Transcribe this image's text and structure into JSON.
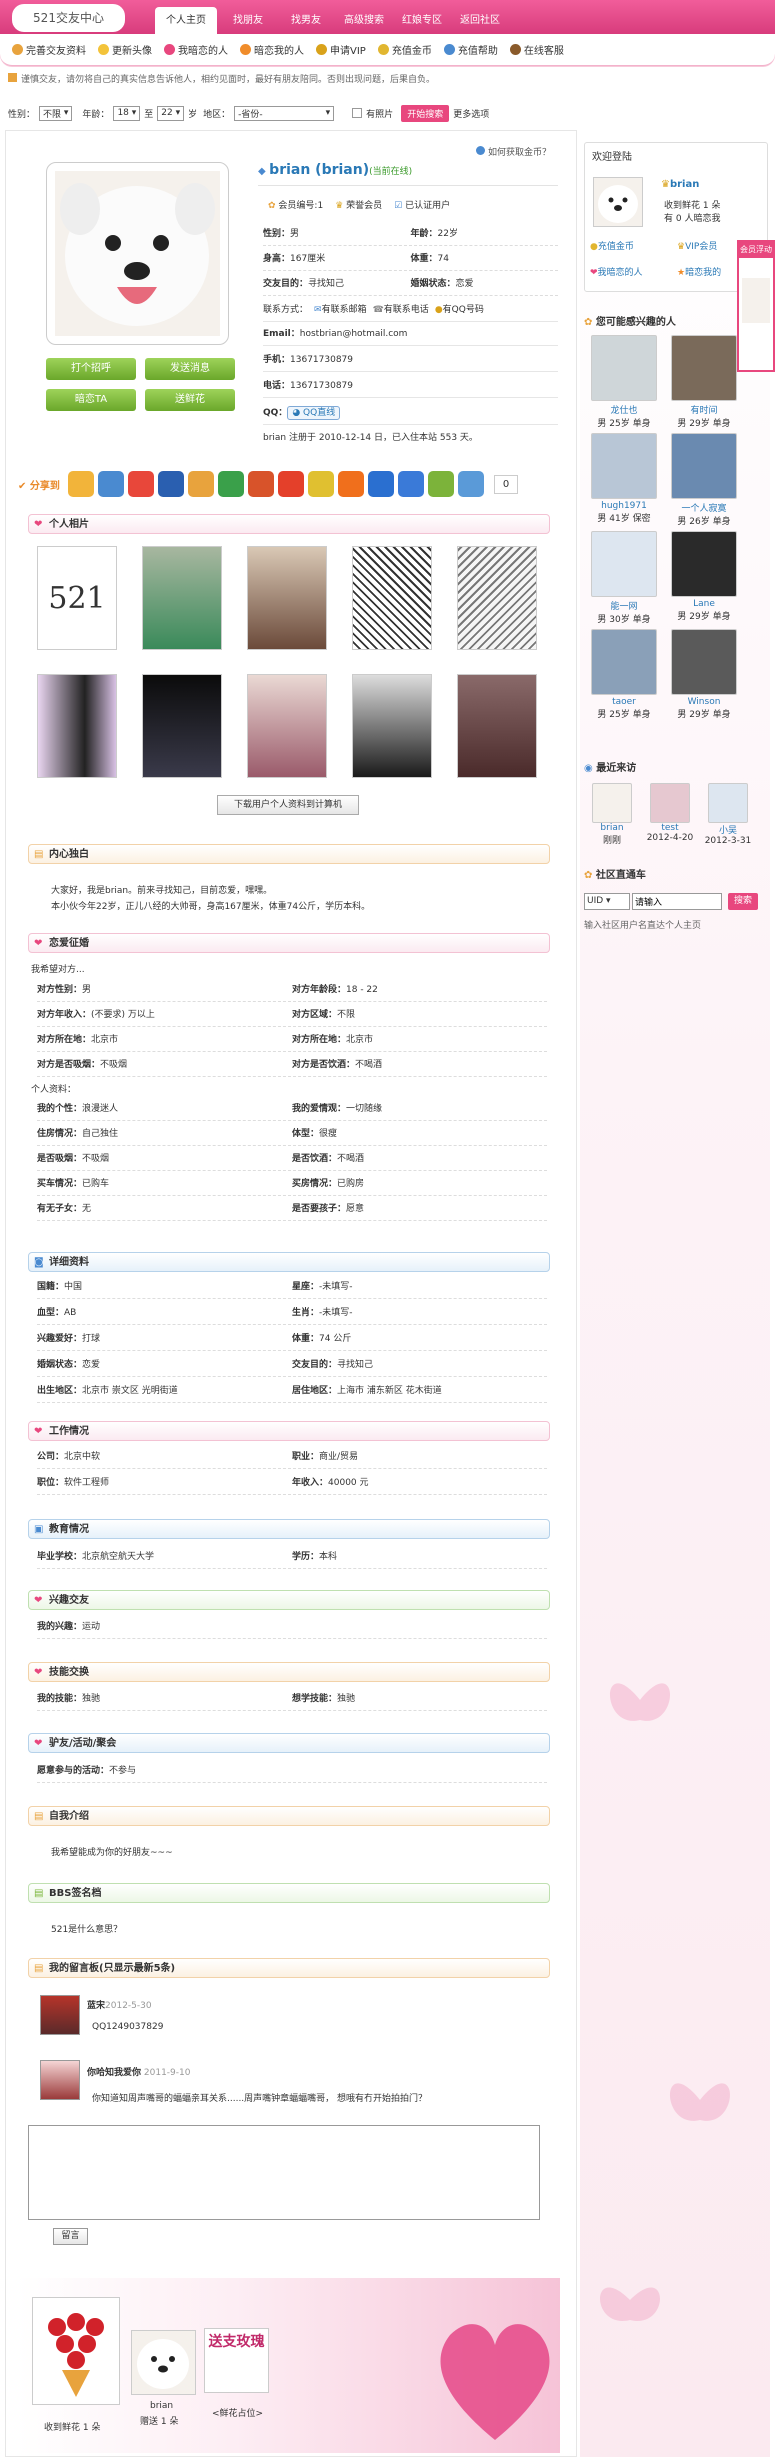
{
  "site": {
    "title": "521交友中心"
  },
  "nav": {
    "tabs": [
      "个人主页",
      "找朋友",
      "找男友",
      "高级搜索",
      "红娘专区",
      "返回社区"
    ]
  },
  "subnav": [
    "完善交友资料",
    "更新头像",
    "我暗恋的人",
    "暗恋我的人",
    "申请VIP",
    "充值金币",
    "充值帮助",
    "在线客服"
  ],
  "notice": "谨慎交友，请勿将自己的真实信息告诉他人，相约见面时，最好有朋友陪同。否则出现问题，后果自负。",
  "search": {
    "gender_label": "性别：",
    "gender": "不限",
    "age_label": "年龄：",
    "age_from": "18",
    "to": "至",
    "age_to": "22",
    "age_unit": "岁",
    "area_label": "地区：",
    "area": "-省份-",
    "photo": "有照片",
    "button": "开始搜索",
    "more": "更多选项"
  },
  "profile": {
    "get_coins": "如何获取金币？",
    "name": "brian (brian)",
    "online": "(当前在线)",
    "member_no": "会员编号:1",
    "honor": "荣誉会员",
    "cert": "已认证用户",
    "fields": [
      [
        "性别：",
        "男",
        "年龄：",
        "22岁"
      ],
      [
        "身高：",
        "167厘米",
        "体重：",
        "74"
      ],
      [
        "交友目的：",
        "寻找知己",
        "婚姻状态：",
        "恋爱"
      ]
    ],
    "contact": "联系方式：",
    "contact_email": "有联系邮箱",
    "contact_phone": "有联系电话",
    "contact_qq": "有QQ号码",
    "email_label": "Email：",
    "email": "hostbrian@hotmail.com",
    "mobile_label": "手机：",
    "mobile": "13671730879",
    "tel_label": "电话：",
    "tel": "13671730879",
    "qq_label": "QQ：",
    "qq_btn": "QQ直线",
    "reg": "brian 注册于 2010-12-14 日，已入住本站 553 天。"
  },
  "actions": {
    "hello": "打个招呼",
    "msg": "发送消息",
    "love": "暗恋TA",
    "flower": "送鲜花"
  },
  "share": {
    "count": "0"
  },
  "photos": {
    "title": "个人相片",
    "download": "下载用户个人资料到计算机",
    "photo_text": "521"
  },
  "mono": {
    "title": "内心独白",
    "text1": "大家好，我是brian。前来寻找知己，目前恋爱，嘿嘿。",
    "text2": "本小伙今年22岁，正儿八经的大帅哥，身高167厘米，体重74公斤，学历本科。"
  },
  "want": {
    "title": "恋爱征婚",
    "line": "我希望对方...",
    "rows": [
      [
        "对方性别：",
        "男",
        "对方年龄段：",
        "18 - 22"
      ],
      [
        "对方年收入：",
        "(不要求) 万以上",
        "对方区域：",
        "不限"
      ],
      [
        "对方所在地：",
        "北京市",
        "对方所在地：",
        "北京市"
      ],
      [
        "对方是否吸烟：",
        "不吸烟",
        "对方是否饮酒：",
        "不喝酒"
      ]
    ],
    "self": "个人资料：",
    "rows2": [
      [
        "我的个性：",
        "浪漫迷人",
        "我的爱情观：",
        "一切随缘"
      ],
      [
        "住房情况：",
        "自己独住",
        "体型：",
        "很瘦"
      ],
      [
        "是否吸烟：",
        "不吸烟",
        "是否饮酒：",
        "不喝酒"
      ],
      [
        "买车情况：",
        "已购车",
        "买房情况：",
        "已购房"
      ],
      [
        "有无子女：",
        "无",
        "是否要孩子：",
        "愿意"
      ]
    ]
  },
  "detail": {
    "title": "详细资料",
    "rows": [
      [
        "国籍：",
        "中国",
        "星座：",
        "-未填写-"
      ],
      [
        "血型：",
        "AB",
        "生肖：",
        "-未填写-"
      ],
      [
        "兴趣爱好：",
        "打球",
        "体重：",
        "74 公斤"
      ],
      [
        "婚姻状态：",
        "恋爱",
        "交友目的：",
        "寻找知己"
      ],
      [
        "出生地区：",
        "北京市 崇文区 光明街道",
        "居住地区：",
        "上海市 浦东新区 花木街道"
      ]
    ]
  },
  "work": {
    "title": "工作情况",
    "rows": [
      [
        "公司：",
        "北京中软",
        "职业：",
        "商业/贸易"
      ],
      [
        "职位：",
        "软件工程师",
        "年收入：",
        "40000 元"
      ]
    ]
  },
  "edu": {
    "title": "教育情况",
    "rows": [
      [
        "毕业学校：",
        "北京航空航天大学",
        "学历：",
        "本科"
      ]
    ]
  },
  "hobby": {
    "title": "兴趣交友",
    "rows": [
      [
        "我的兴趣：",
        "运动"
      ]
    ]
  },
  "skill": {
    "title": "技能交换",
    "rows": [
      [
        "我的技能：",
        "独驰",
        "想学技能：",
        "独驰"
      ]
    ]
  },
  "party": {
    "title": "驴友/活动/聚会",
    "rows": [
      [
        "愿意参与的活动：",
        "不参与"
      ]
    ]
  },
  "intro": {
    "title": "自我介绍",
    "text": "我希望能成为你的好朋友~~~"
  },
  "bbs": {
    "title": "BBS签名档",
    "text": "521是什么意思？"
  },
  "msgboard": {
    "title": "我的留言板(只显示最新5条)",
    "items": [
      {
        "name": "蓝宋",
        "date": "2012-5-30",
        "text": "QQ1249037829"
      },
      {
        "name": "你哈知我爱你",
        "date": "2011-9-10",
        "text": "你知道知周声嘴哥的蝠蝠亲耳关系......周声嘴钟章蝠蝠嘴哥， 想哦有冇开始拍拍门？"
      }
    ],
    "button": "留言"
  },
  "gifts": {
    "received": "收到鲜花 1 朵",
    "giver": "brian",
    "giver_note": "赠送 1 朵",
    "rose_label": "<鲜花占位>",
    "rose_text": "送支玫瑰"
  },
  "side": {
    "welcome": "欢迎登陆",
    "user": "brian",
    "user_sub": "收到鲜花 1 朵",
    "user_sub2": "有 0 人暗恋我",
    "links": [
      "充值金币",
      "VIP会员",
      "我暗恋的人",
      "暗恋我的"
    ],
    "float_tab": "会员浮动",
    "interest_title": "您可能感兴趣的人",
    "people": [
      {
        "name": "龙仕也",
        "info": "男 25岁 单身"
      },
      {
        "name": "有时间",
        "info": "男 29岁 单身"
      },
      {
        "name": "hugh1971",
        "info": "男 41岁 保密"
      },
      {
        "name": "一个人寂寞",
        "info": "男 26岁 单身"
      },
      {
        "name": "能一网",
        "info": "男 30岁 单身"
      },
      {
        "name": "Lane",
        "info": "男 29岁 单身"
      },
      {
        "name": "taoer",
        "info": "男 25岁 单身"
      },
      {
        "name": "Winson",
        "info": "男 29岁 单身"
      }
    ],
    "visitors_title": "最近来访",
    "visitors": [
      {
        "name": "brian",
        "date": "刚刚"
      },
      {
        "name": "test",
        "date": "2012-4-20"
      },
      {
        "name": "小吴",
        "date": "2012-3-31"
      }
    ],
    "community_title": "社区直通车",
    "uid": "UID",
    "input_placeholder": "请输入",
    "search_btn": "搜索",
    "hint": "输入社区用户名直达个人主页"
  },
  "colors": {
    "pink": "#e8477e",
    "nav": "#e14c87",
    "blue": "#2a79b6",
    "green": "#7ab63a"
  }
}
